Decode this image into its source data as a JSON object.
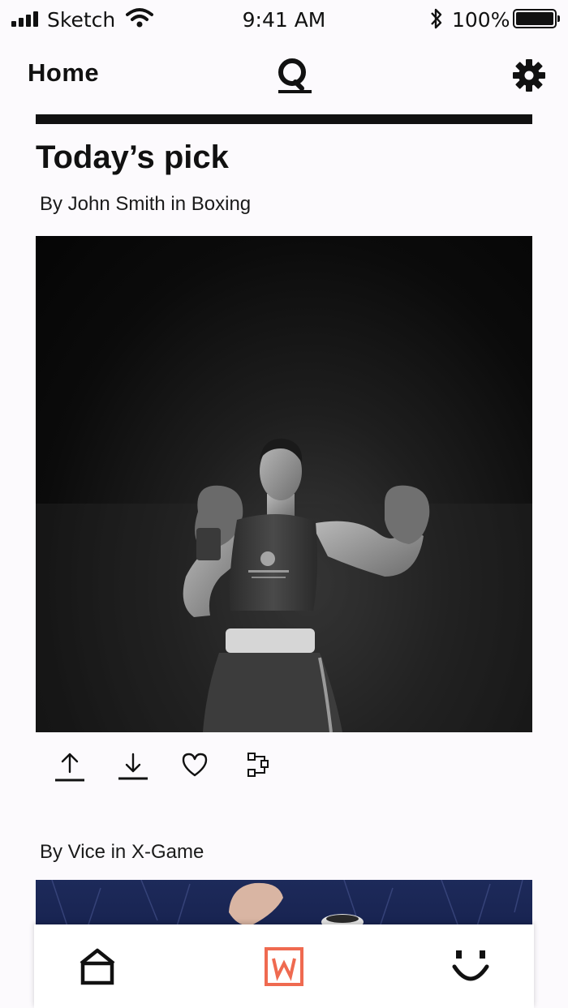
{
  "status_bar": {
    "carrier": "Sketch",
    "time": "9:41 AM",
    "battery_percent": "100%",
    "icons": [
      "signal-icon",
      "wifi-icon",
      "bluetooth-icon",
      "battery-icon"
    ]
  },
  "nav": {
    "title": "Home",
    "icons": [
      "search-icon",
      "gear-icon"
    ]
  },
  "feed": {
    "section_title": "Today’s pick",
    "items": [
      {
        "byline": "By John Smith in Boxing",
        "image": "boxer-photo"
      },
      {
        "byline": "By Vice in X-Game",
        "image": "x-game-photo"
      }
    ],
    "actions": [
      "share-icon",
      "download-icon",
      "heart-icon",
      "collection-icon"
    ]
  },
  "tab_bar": {
    "tabs": [
      {
        "icon": "home-icon",
        "active": false
      },
      {
        "icon": "w-logo-icon",
        "active": true,
        "color": "#ef6a50"
      },
      {
        "icon": "smile-icon",
        "active": false
      }
    ]
  },
  "colors": {
    "background": "#fcfafd",
    "text": "#111111",
    "accent": "#ef6a50"
  }
}
